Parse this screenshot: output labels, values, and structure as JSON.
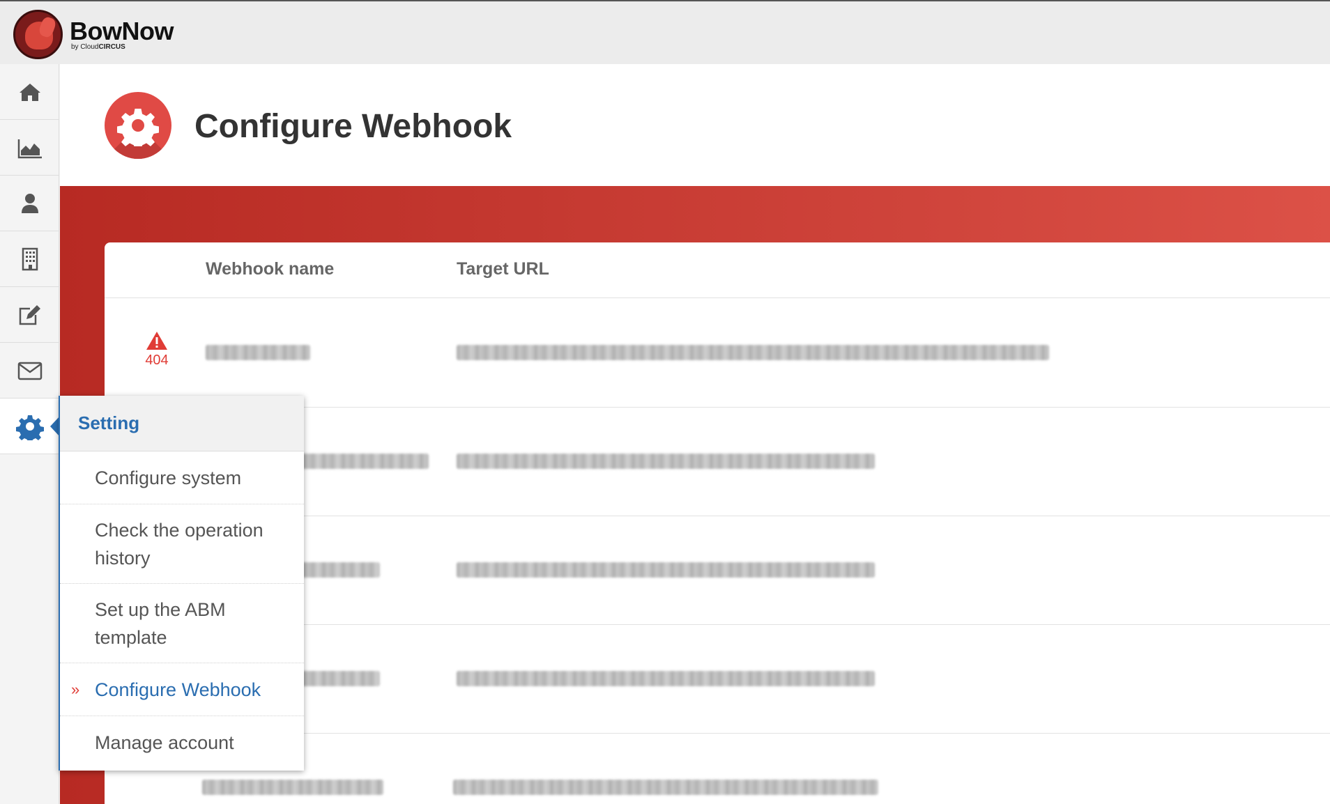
{
  "brand": {
    "name": "BowNow",
    "sub_prefix": "by Cloud",
    "sub_bold": "CIRCUS"
  },
  "sidebar": {
    "items": [
      {
        "icon": "home-icon"
      },
      {
        "icon": "area-chart-icon"
      },
      {
        "icon": "user-icon"
      },
      {
        "icon": "building-icon"
      },
      {
        "icon": "edit-icon"
      },
      {
        "icon": "envelope-icon"
      },
      {
        "icon": "gear-icon",
        "active": true
      }
    ]
  },
  "page": {
    "title": "Configure Webhook",
    "icon": "gear-icon"
  },
  "table": {
    "columns": [
      "Webhook name",
      "Target URL"
    ],
    "rows": [
      {
        "status_code": "404",
        "status_icon": "warning-icon"
      },
      {},
      {},
      {},
      {}
    ]
  },
  "menu": {
    "title": "Setting",
    "items": [
      {
        "label": "Configure system"
      },
      {
        "label": "Check the operation history"
      },
      {
        "label": "Set up the ABM template"
      },
      {
        "label": "Configure Webhook",
        "active": true
      },
      {
        "label": "Manage account"
      }
    ]
  },
  "colors": {
    "accent_red": "#e03c36",
    "accent_blue": "#2a6db0",
    "band_red": "#c2322b"
  }
}
